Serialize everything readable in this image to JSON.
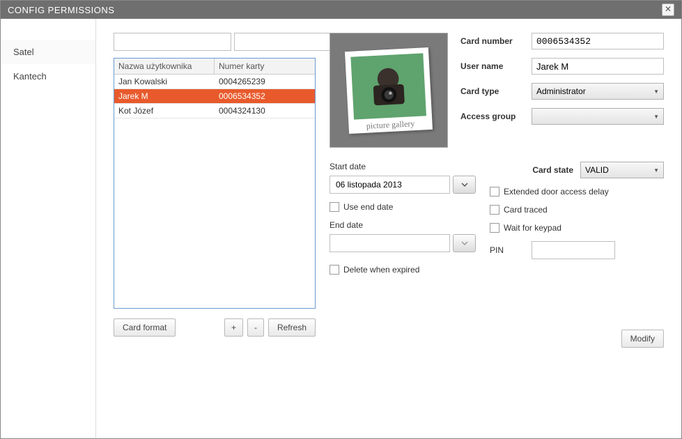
{
  "window": {
    "title": "CONFIG PERMISSIONS"
  },
  "sidebar": {
    "items": [
      {
        "label": "Satel",
        "active": false
      },
      {
        "label": "Kantech",
        "active": true
      }
    ]
  },
  "filters": {
    "name_filter": "",
    "card_filter": ""
  },
  "table": {
    "headers": {
      "name": "Nazwa użytkownika",
      "card": "Numer karty"
    },
    "rows": [
      {
        "name": "Jan Kowalski",
        "card": "0004265239",
        "selected": false
      },
      {
        "name": "Jarek M",
        "card": "0006534352",
        "selected": true
      },
      {
        "name": "Kot Józef",
        "card": "0004324130",
        "selected": false
      }
    ]
  },
  "table_actions": {
    "card_format": "Card format",
    "add": "+",
    "remove": "-",
    "refresh": "Refresh"
  },
  "photo": {
    "caption": "picture gallery"
  },
  "form": {
    "card_number_label": "Card number",
    "card_number": "0006534352",
    "user_name_label": "User name",
    "user_name": "Jarek M",
    "card_type_label": "Card type",
    "card_type": "Administrator",
    "access_group_label": "Access group",
    "access_group": ""
  },
  "dates": {
    "start_label": "Start date",
    "start_value": "06 listopada 2013",
    "use_end_label": "Use end date",
    "end_label": "End date",
    "end_value": "",
    "delete_expired_label": "Delete when expired"
  },
  "card_state": {
    "label": "Card state",
    "value": "VALID",
    "ext_delay_label": "Extended door access delay",
    "traced_label": "Card traced",
    "wait_keypad_label": "Wait for keypad",
    "pin_label": "PIN",
    "pin_value": ""
  },
  "modify_label": "Modify"
}
